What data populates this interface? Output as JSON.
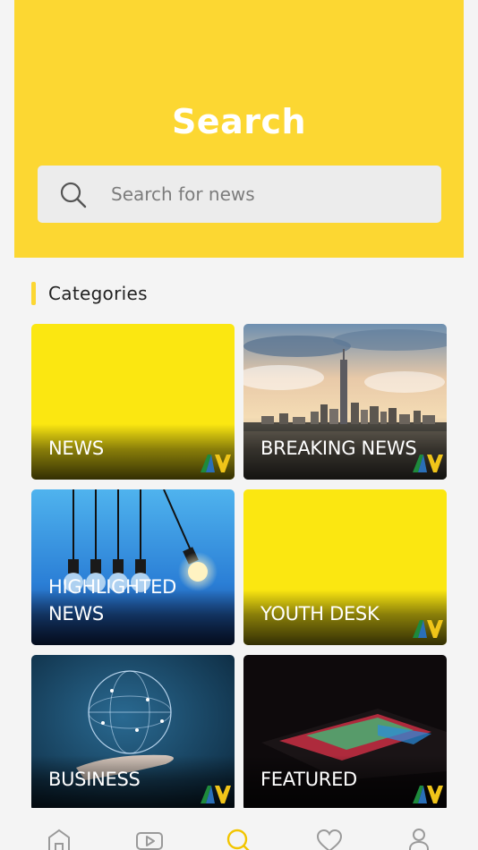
{
  "header": {
    "title": "Search",
    "search_placeholder": "Search for news"
  },
  "categories": {
    "title": "Categories",
    "items": [
      {
        "label": "NEWS",
        "image": "yellow"
      },
      {
        "label": "BREAKING NEWS",
        "image": "city-skyline"
      },
      {
        "label": "HIGHLIGHTED NEWS",
        "image": "light-bulbs"
      },
      {
        "label": "YOUTH DESK",
        "image": "yellow"
      },
      {
        "label": "BUSINESS",
        "image": "globe-hand"
      },
      {
        "label": "FEATURED",
        "image": "laptop-keyboard"
      }
    ]
  },
  "colors": {
    "accent": "#fcd732",
    "card_yellow": "#fbe711",
    "background": "#f4f4f4"
  },
  "nav": {
    "items": [
      {
        "name": "home",
        "icon": "home-icon",
        "active": false
      },
      {
        "name": "videos",
        "icon": "video-icon",
        "active": false
      },
      {
        "name": "search",
        "icon": "search-icon",
        "active": true
      },
      {
        "name": "favorites",
        "icon": "heart-icon",
        "active": false
      },
      {
        "name": "profile",
        "icon": "user-icon",
        "active": false
      }
    ]
  }
}
